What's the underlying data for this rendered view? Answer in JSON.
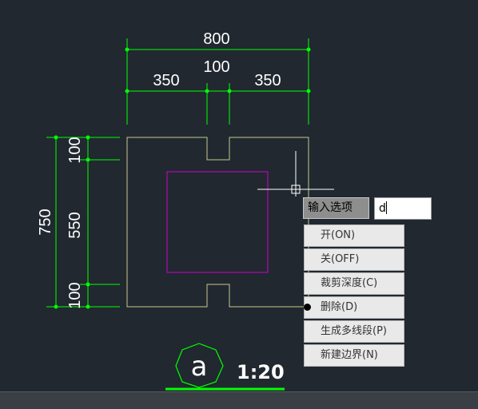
{
  "drawing": {
    "dimensions": {
      "top_total": "800",
      "top_left": "350",
      "top_middle": "100",
      "top_right": "350",
      "left_total": "750",
      "left_top": "100",
      "left_middle": "550",
      "left_bottom": "100"
    },
    "label_symbol": "a",
    "scale": "1:20",
    "colors": {
      "dimension": "#00ff00",
      "outline": "#c8c88c",
      "inner_rect": "#d000d0",
      "crosshair": "#ffffff"
    }
  },
  "command_prompt": {
    "label": "输入选项",
    "input_value": "d"
  },
  "option_menu": {
    "items": [
      {
        "label": "开(ON)",
        "selected": false
      },
      {
        "label": "关(OFF)",
        "selected": false
      },
      {
        "label": "裁剪深度(C)",
        "selected": false
      },
      {
        "label": "删除(D)",
        "selected": true
      },
      {
        "label": "生成多线段(P)",
        "selected": false
      },
      {
        "label": "新建边界(N)",
        "selected": false
      }
    ]
  }
}
